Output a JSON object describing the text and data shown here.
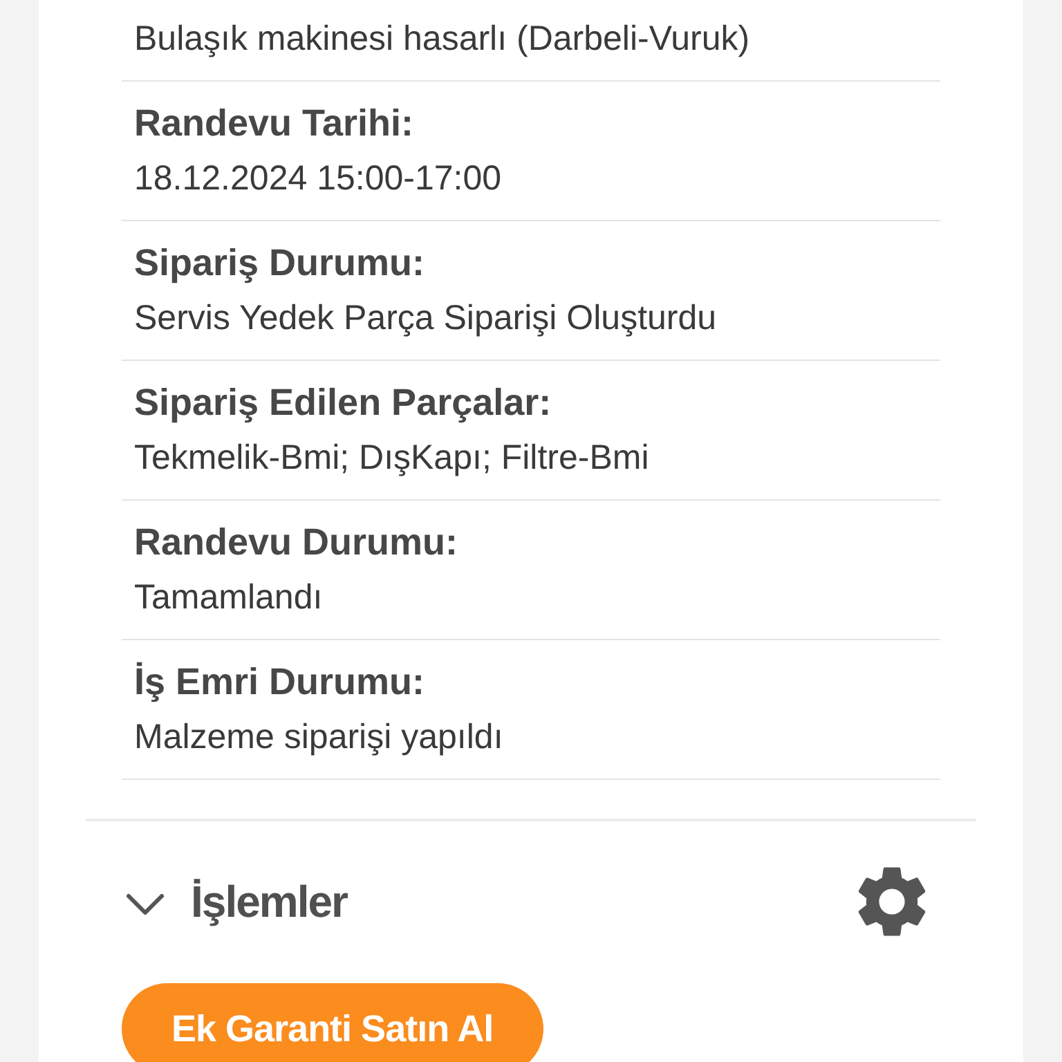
{
  "details": [
    {
      "value": "Bulaşık makinesi hasarlı (Darbeli-Vuruk)"
    },
    {
      "label": "Randevu Tarihi:",
      "value": "18.12.2024 15:00-17:00"
    },
    {
      "label": "Sipariş Durumu:",
      "value": "Servis Yedek Parça Siparişi Oluşturdu"
    },
    {
      "label": "Sipariş Edilen Parçalar:",
      "value": "Tekmelik-Bmi; DışKapı; Filtre-Bmi"
    },
    {
      "label": "Randevu Durumu:",
      "value": "Tamamlandı"
    },
    {
      "label": "İş Emri Durumu:",
      "value": "Malzeme siparişi yapıldı"
    }
  ],
  "actions": {
    "title": "İşlemler",
    "expanded": true,
    "button": "Ek Garanti Satın Al"
  }
}
